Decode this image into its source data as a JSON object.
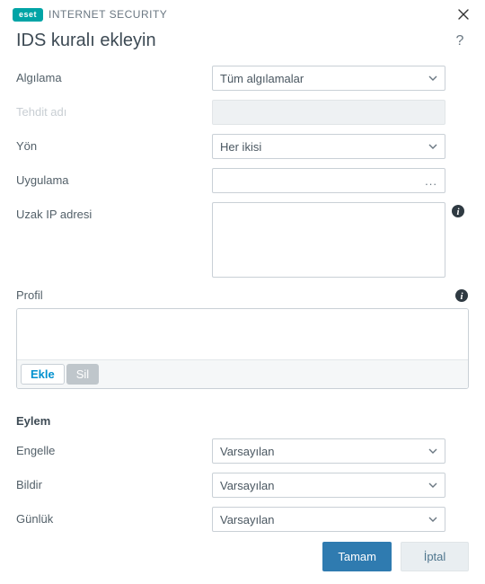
{
  "brand": {
    "logo_text": "eset",
    "product_name": "INTERNET SECURITY"
  },
  "window": {
    "title": "IDS kuralı ekleyin"
  },
  "fields": {
    "detection_label": "Algılama",
    "detection_value": "Tüm algılamalar",
    "threat_name_label": "Tehdit adı",
    "direction_label": "Yön",
    "direction_value": "Her ikisi",
    "application_label": "Uygulama",
    "remote_ip_label": "Uzak IP adresi"
  },
  "profile": {
    "label": "Profil",
    "add_label": "Ekle",
    "delete_label": "Sil"
  },
  "action": {
    "section_title": "Eylem",
    "block_label": "Engelle",
    "block_value": "Varsayılan",
    "notify_label": "Bildir",
    "notify_value": "Varsayılan",
    "log_label": "Günlük",
    "log_value": "Varsayılan"
  },
  "buttons": {
    "ok": "Tamam",
    "cancel": "İptal"
  },
  "icons": {
    "browse_ellipsis": "..."
  }
}
